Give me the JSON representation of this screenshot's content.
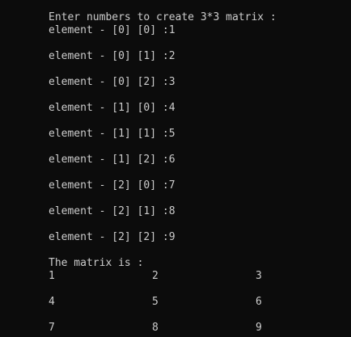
{
  "console": {
    "prompt": "Enter numbers to create 3*3 matrix :",
    "element_lines": [
      "element - [0] [0] :1",
      "element - [0] [1] :2",
      "element - [0] [2] :3",
      "element - [1] [0] :4",
      "element - [1] [1] :5",
      "element - [1] [2] :6",
      "element - [2] [0] :7",
      "element - [2] [1] :8",
      "element - [2] [2] :9"
    ],
    "matrix_heading": "The matrix is :",
    "matrix": [
      [
        "1",
        "2",
        "3"
      ],
      [
        "4",
        "5",
        "6"
      ],
      [
        "7",
        "8",
        "9"
      ]
    ],
    "colors": {
      "background": "#0c0c0c",
      "text": "#cccccc"
    }
  }
}
